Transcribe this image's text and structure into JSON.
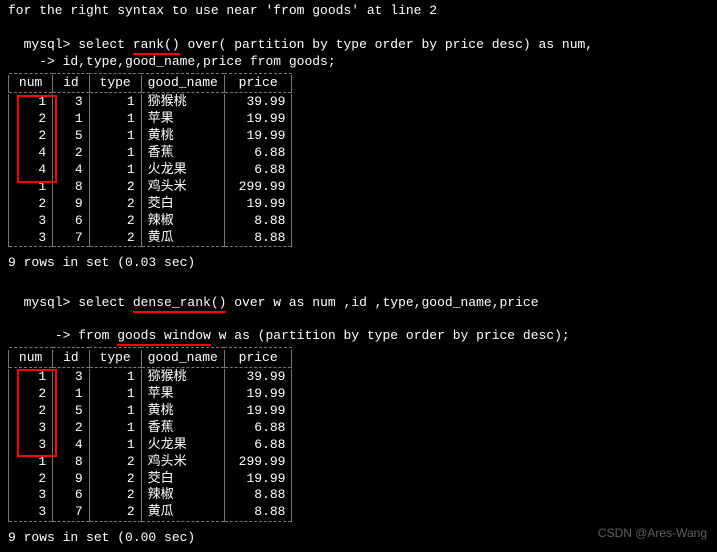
{
  "top_error": "for the right syntax to use near 'from goods' at line 2",
  "query1": {
    "prompt": "mysql> ",
    "before_fn": "select ",
    "fn": "rank()",
    "after_fn": " over( partition by type order by price desc) as num,",
    "cont": "    -> id,type,good_name,price from goods;"
  },
  "headers": [
    "num",
    "id",
    "type",
    "good_name",
    "price"
  ],
  "rows1": [
    {
      "num": "1",
      "id": "3",
      "type": "1",
      "good_name": "猕猴桃",
      "price": "39.99"
    },
    {
      "num": "2",
      "id": "1",
      "type": "1",
      "good_name": "苹果",
      "price": "19.99"
    },
    {
      "num": "2",
      "id": "5",
      "type": "1",
      "good_name": "黄桃",
      "price": "19.99"
    },
    {
      "num": "4",
      "id": "2",
      "type": "1",
      "good_name": "香蕉",
      "price": "6.88"
    },
    {
      "num": "4",
      "id": "4",
      "type": "1",
      "good_name": "火龙果",
      "price": "6.88"
    },
    {
      "num": "1",
      "id": "8",
      "type": "2",
      "good_name": "鸡头米",
      "price": "299.99"
    },
    {
      "num": "2",
      "id": "9",
      "type": "2",
      "good_name": "茭白",
      "price": "19.99"
    },
    {
      "num": "3",
      "id": "6",
      "type": "2",
      "good_name": "辣椒",
      "price": "8.88"
    },
    {
      "num": "3",
      "id": "7",
      "type": "2",
      "good_name": "黄瓜",
      "price": "8.88"
    }
  ],
  "status1": "9 rows in set (0.03 sec)",
  "query2": {
    "prompt": "mysql> ",
    "before_fn": "select ",
    "fn": "dense_rank()",
    "after_fn": " over w as num ,id ,type,good_name,price",
    "cont_before": "    -> from ",
    "cont_under": "goods window",
    "cont_after": " w as (partition by type order by price desc);"
  },
  "rows2": [
    {
      "num": "1",
      "id": "3",
      "type": "1",
      "good_name": "猕猴桃",
      "price": "39.99"
    },
    {
      "num": "2",
      "id": "1",
      "type": "1",
      "good_name": "苹果",
      "price": "19.99"
    },
    {
      "num": "2",
      "id": "5",
      "type": "1",
      "good_name": "黄桃",
      "price": "19.99"
    },
    {
      "num": "3",
      "id": "2",
      "type": "1",
      "good_name": "香蕉",
      "price": "6.88"
    },
    {
      "num": "3",
      "id": "4",
      "type": "1",
      "good_name": "火龙果",
      "price": "6.88"
    },
    {
      "num": "1",
      "id": "8",
      "type": "2",
      "good_name": "鸡头米",
      "price": "299.99"
    },
    {
      "num": "2",
      "id": "9",
      "type": "2",
      "good_name": "茭白",
      "price": "19.99"
    },
    {
      "num": "3",
      "id": "6",
      "type": "2",
      "good_name": "辣椒",
      "price": "8.88"
    },
    {
      "num": "3",
      "id": "7",
      "type": "2",
      "good_name": "黄瓜",
      "price": "8.88"
    }
  ],
  "status2": "9 rows in set (0.00 sec)",
  "watermark": "CSDN @Ares-Wang"
}
